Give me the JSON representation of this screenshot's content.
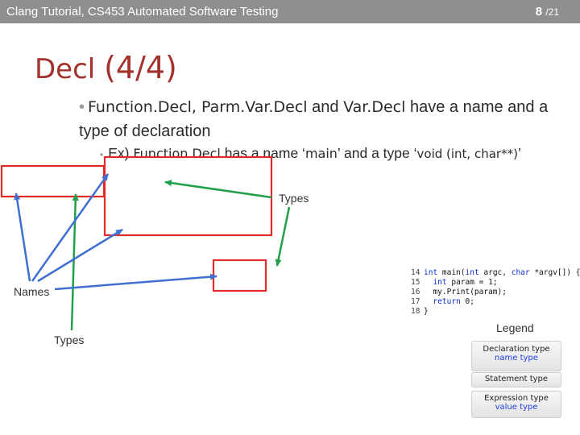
{
  "header": {
    "course": "Clang Tutorial, CS453 Automated Software Testing",
    "page_current": "8",
    "page_total": "/21"
  },
  "slide": {
    "title_main": "Decl",
    "title_paren": "(4/4)",
    "bullet1": {
      "part1": "Function.Decl, Parm.Var.Decl",
      "part2": " and ",
      "part3": "Var.Decl",
      "part4": " have a name and a type of declaration"
    },
    "bullet2": {
      "prefix": "Ex) ",
      "fn": "Function.Decl",
      "mid1": " has a name ‘",
      "name": "main",
      "mid2": "’ and a type ‘",
      "type": "void (int, char**)",
      "end": "’"
    }
  },
  "annotations": {
    "types_top": "Types",
    "names": "Names",
    "types_bottom": "Types"
  },
  "code": {
    "lines": [
      {
        "num": "14",
        "kw": "int",
        "rest": " main(",
        "kw2": "int",
        "rest2": " argc, ",
        "kw3": "char",
        "rest3": " *argv[]) {"
      },
      {
        "num": "15",
        "kw": "int",
        "rest": " param = 1;"
      },
      {
        "num": "16",
        "kw": "",
        "rest": "my.Print(param);"
      },
      {
        "num": "17",
        "kw": "return",
        "rest": " 0;"
      },
      {
        "num": "18",
        "kw": "",
        "rest": "}"
      }
    ]
  },
  "legend": {
    "title": "Legend",
    "declaration": {
      "line1": "Declaration type",
      "line2": "name type"
    },
    "statement": {
      "line1": "Statement type"
    },
    "expression": {
      "line1": "Expression type",
      "line2": "value type"
    }
  },
  "colors": {
    "header_bg": "#8f8f8f",
    "title": "#a2322b",
    "box_red": "#e32a2a",
    "arrow_green": "#21a04a",
    "arrow_blue": "#3f6fd0",
    "code_keyword": "#0b2cc9"
  }
}
